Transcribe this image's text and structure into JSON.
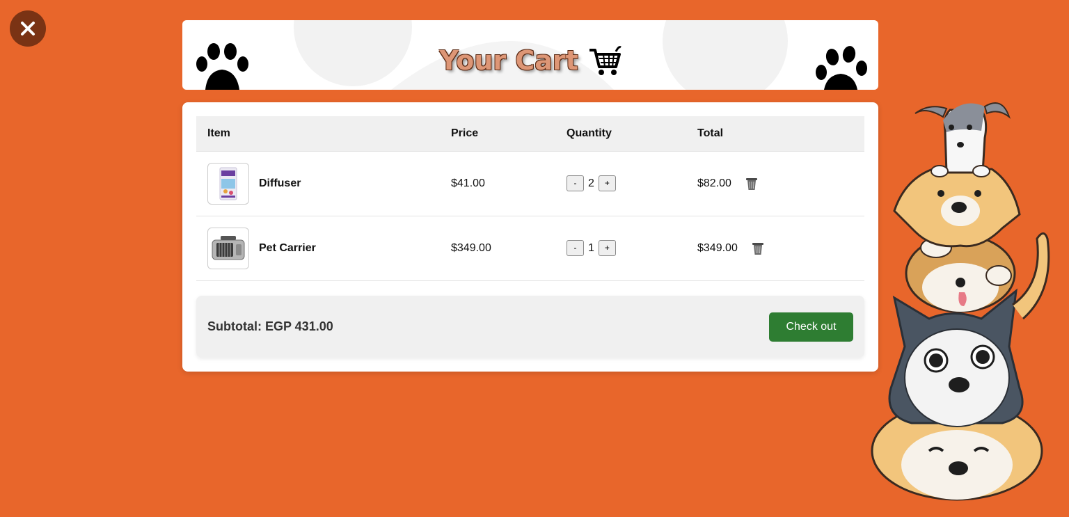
{
  "header": {
    "title": "Your Cart"
  },
  "table": {
    "columns": [
      "Item",
      "Price",
      "Quantity",
      "Total"
    ],
    "rows": [
      {
        "name": "Diffuser",
        "price": "$41.00",
        "quantity": "2",
        "total": "$82.00",
        "image": "diffuser-product-image"
      },
      {
        "name": "Pet Carrier",
        "price": "$349.00",
        "quantity": "1",
        "total": "$349.00",
        "image": "pet-carrier-product-image"
      }
    ],
    "minus_label": "-",
    "plus_label": "+"
  },
  "summary": {
    "subtotal": "Subtotal: EGP 431.00",
    "checkout_label": "Check out"
  },
  "colors": {
    "background": "#e8662b",
    "close_button": "#7a3314",
    "checkout_button": "#2e7d32",
    "title_text": "#dd9676"
  },
  "icons": [
    "close-icon",
    "paw-icon",
    "shopping-cart-icon",
    "trash-icon",
    "dogs-illustration"
  ]
}
